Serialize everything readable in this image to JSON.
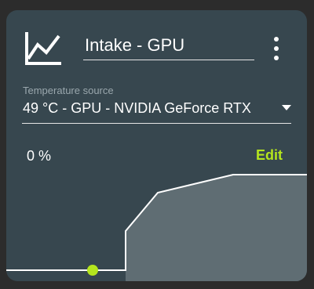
{
  "card": {
    "title": "Intake - GPU",
    "icon": "line-chart-icon",
    "menu_icon": "more-vertical-icon"
  },
  "temperature_source": {
    "label": "Temperature source",
    "value": "49 °C - GPU - NVIDIA GeForce RTX",
    "icon": "dropdown-arrow-icon"
  },
  "fan": {
    "speed": "0 %",
    "edit_label": "Edit"
  },
  "colors": {
    "card_background": "#37474f",
    "accent": "#b5e61d",
    "curve_fill": "#5f6d73",
    "text": "#ffffff"
  }
}
